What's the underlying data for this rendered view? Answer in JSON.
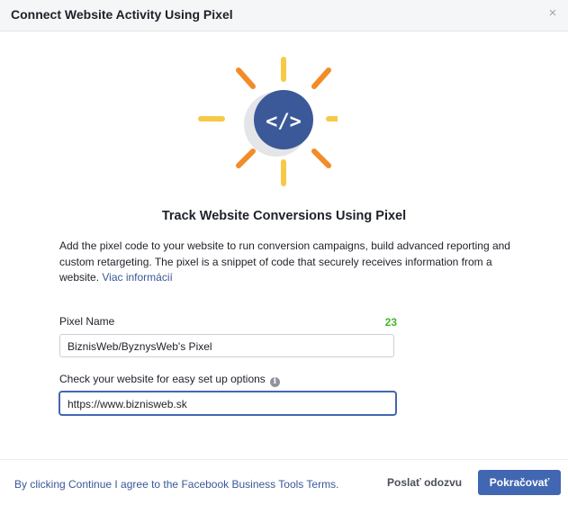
{
  "dialog": {
    "title": "Connect Website Activity Using Pixel",
    "close_glyph": "×"
  },
  "illustration": {
    "icon": "code-brackets-icon",
    "code_glyph": "</>",
    "colors": {
      "circle": "#3b5998",
      "shadow": "#e4e5e8",
      "ray_yellow": "#f7c948",
      "ray_orange": "#f28c28"
    }
  },
  "main": {
    "heading": "Track Website Conversions Using Pixel",
    "description": "Add the pixel code to your website to run conversion campaigns, build advanced reporting and custom retargeting. The pixel is a snippet of code that securely receives information from a website.",
    "learn_more_link": "Viac informácií"
  },
  "form": {
    "pixel_name_label": "Pixel Name",
    "pixel_name_counter": "23",
    "pixel_name_value": "BiznisWeb/ByznysWeb's Pixel",
    "website_label": "Check your website for easy set up options",
    "website_value": "https://www.biznisweb.sk"
  },
  "footer": {
    "terms_text": "By clicking Continue I agree to the Facebook Business Tools Terms.",
    "feedback_label": "Poslať odozvu",
    "continue_label": "Pokračovať"
  },
  "colors": {
    "accent": "#4267b2",
    "link": "#385898",
    "counter": "#42b72a"
  }
}
